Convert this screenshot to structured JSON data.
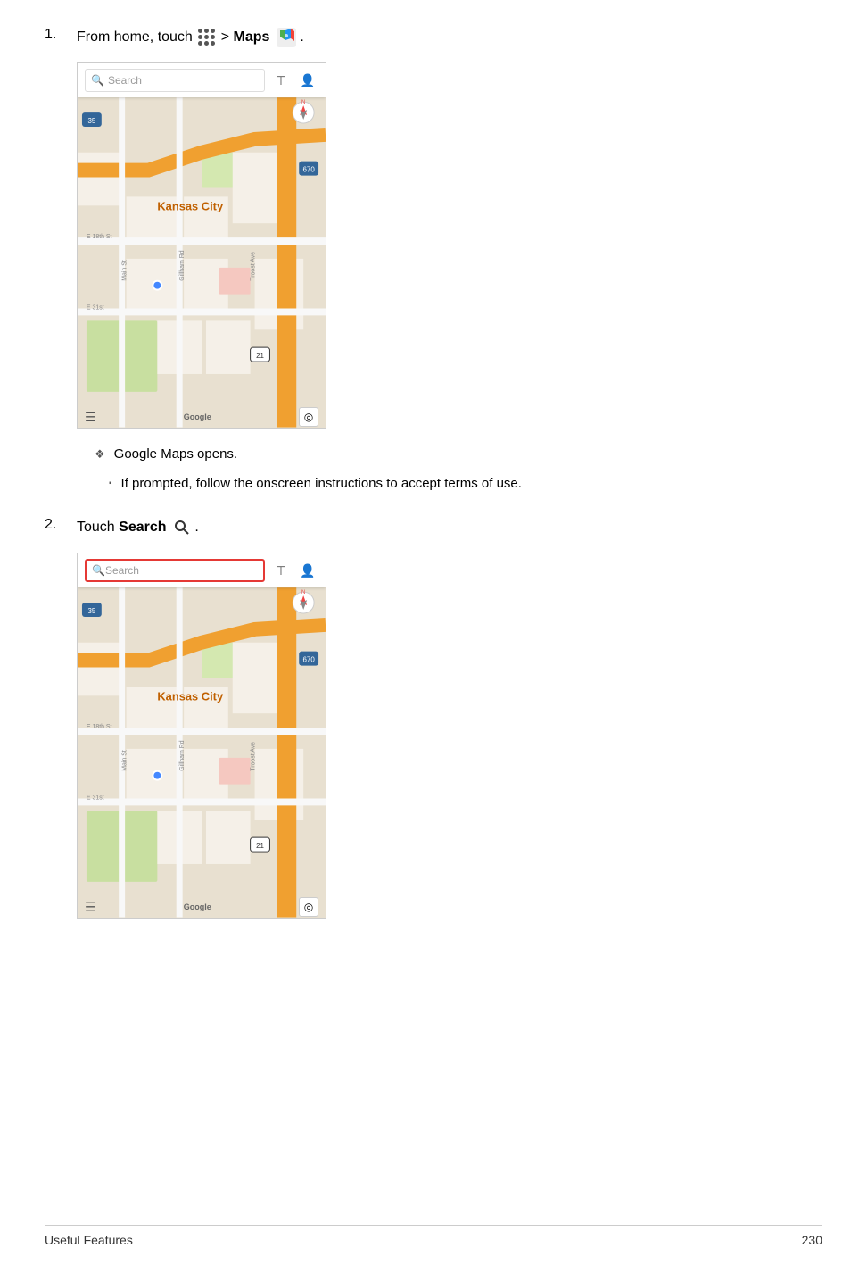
{
  "page": {
    "footer": {
      "left_label": "Useful Features",
      "page_number": "230"
    }
  },
  "step1": {
    "number": "1.",
    "text_prefix": "From home, touch ",
    "text_middle": " > ",
    "maps_label": "Maps",
    "text_suffix": ".",
    "bullets": [
      {
        "type": "diamond",
        "text": "Google Maps opens."
      }
    ],
    "sub_bullets": [
      {
        "type": "square",
        "text": "If prompted, follow the onscreen instructions to accept terms of use."
      }
    ]
  },
  "step2": {
    "number": "2.",
    "text_prefix": "Touch ",
    "search_label": "Search",
    "text_suffix": "."
  },
  "map1": {
    "search_placeholder": "Search",
    "label": "Kansas City"
  },
  "map2": {
    "search_placeholder": "Search",
    "label": "Kansas City"
  },
  "icons": {
    "apps": "apps-icon",
    "search": "🔍",
    "filter": "⊤",
    "person": "👤",
    "menu": "☰",
    "google": "Google",
    "location": "◎"
  }
}
